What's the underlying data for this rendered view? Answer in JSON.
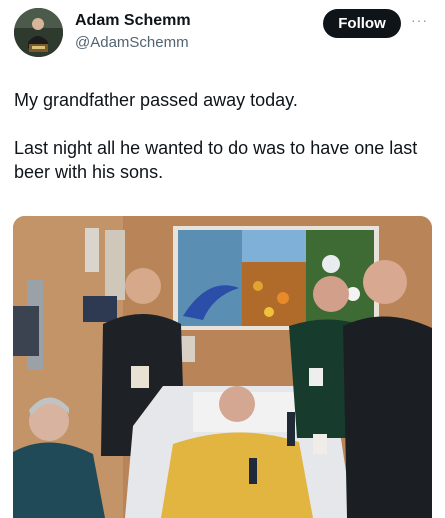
{
  "author": {
    "name": "Adam Schemm",
    "handle": "@AdamSchemm"
  },
  "actions": {
    "follow_label": "Follow",
    "more_label": "···"
  },
  "tweet": {
    "paragraphs": [
      "My grandfather passed away today.",
      "Last night all he wanted to do was to have one last beer with his sons."
    ]
  },
  "media": {
    "description_icon": "photo-hospital-room"
  },
  "colors": {
    "follow_bg": "#0f1419",
    "handle": "#536471",
    "text": "#0f1419"
  }
}
